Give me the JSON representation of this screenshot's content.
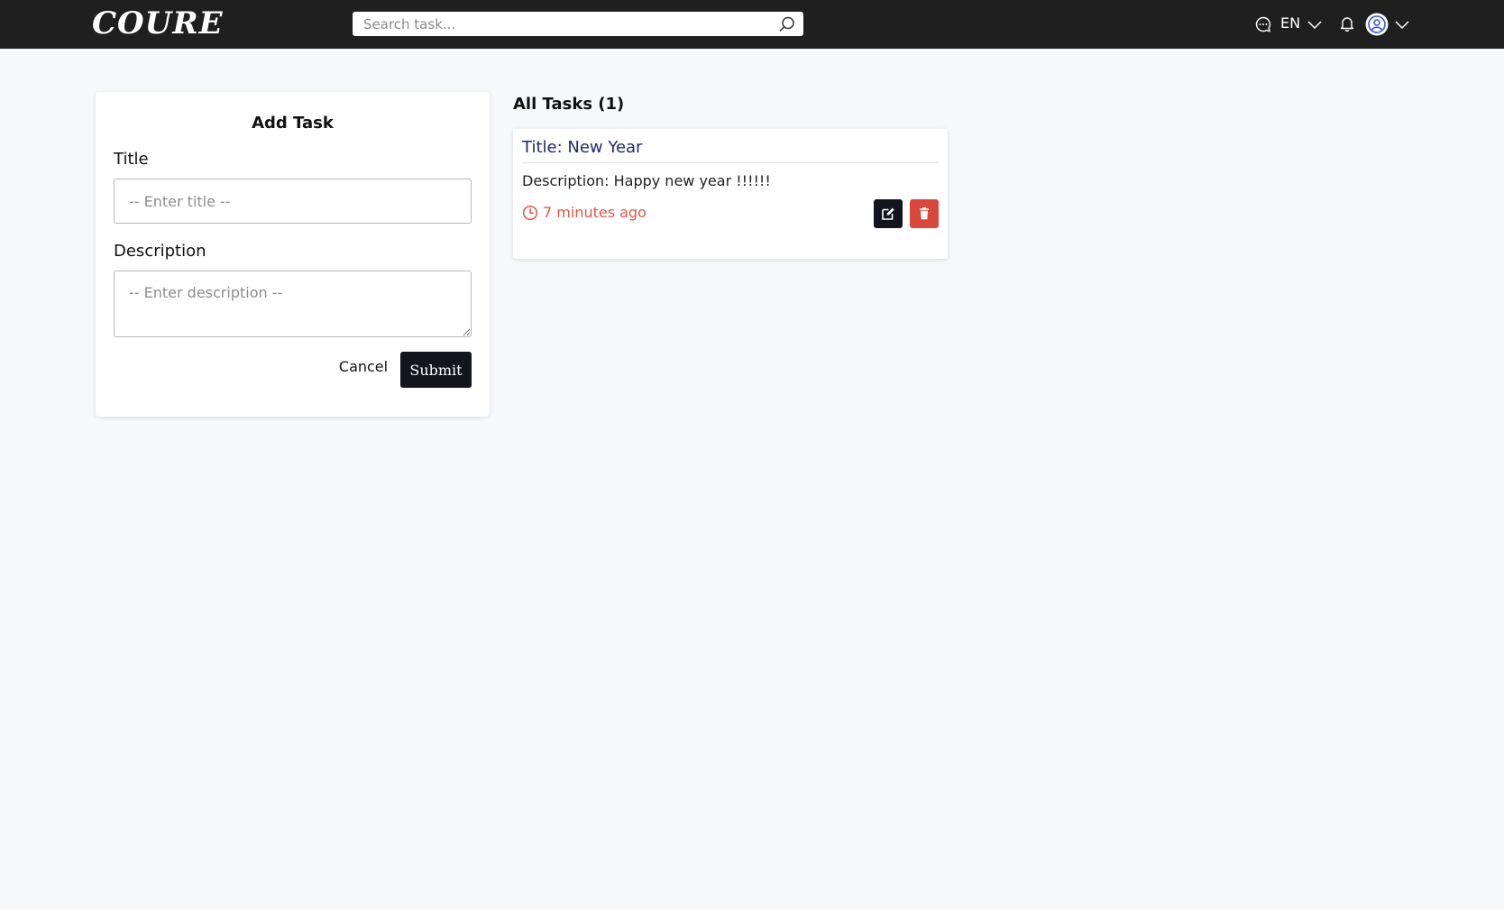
{
  "navbar": {
    "logo": "COURE",
    "search": {
      "placeholder": "Search task...",
      "icon": "search-icon"
    },
    "language": "EN",
    "icons": [
      "chat-icon",
      "chevron-down-icon",
      "bell-icon",
      "avatar-icon",
      "chevron-down-icon"
    ]
  },
  "add_task": {
    "heading": "Add Task",
    "title_label": "Title",
    "title_placeholder": "-- Enter title --",
    "description_label": "Description",
    "description_placeholder": "-- Enter description --",
    "cancel_label": "Cancel",
    "submit_label": "Submit"
  },
  "tasks": {
    "heading": "All Tasks (1)",
    "items": [
      {
        "title": "Title: New Year",
        "description": "Description: Happy new year !!!!!!",
        "time": "7 minutes ago",
        "icons": [
          "clock-icon",
          "edit-icon",
          "trash-icon"
        ]
      }
    ]
  },
  "colors": {
    "navbar_bg": "#1f1f1f",
    "page_bg": "#f7f8fa",
    "primary_button": "#14141e",
    "danger_button": "#d9483b",
    "task_title": "#1f2a6b",
    "time_text": "#e0574b"
  }
}
